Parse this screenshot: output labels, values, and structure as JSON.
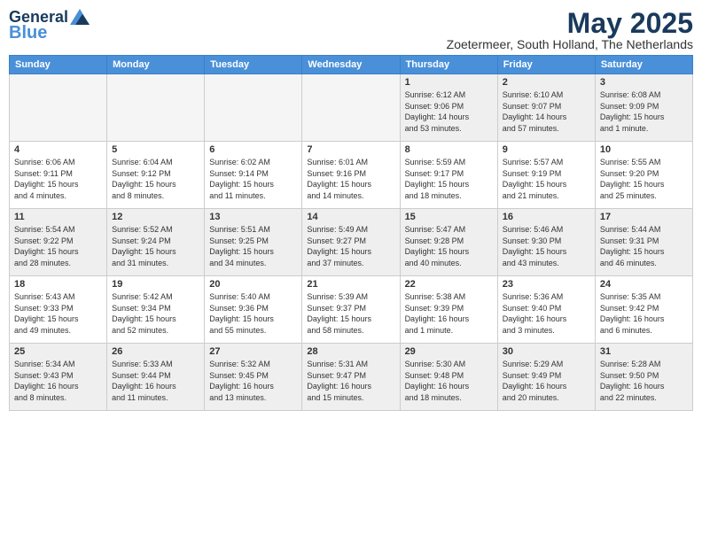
{
  "header": {
    "logo_line1": "General",
    "logo_line2": "Blue",
    "month": "May 2025",
    "location": "Zoetermeer, South Holland, The Netherlands"
  },
  "days_of_week": [
    "Sunday",
    "Monday",
    "Tuesday",
    "Wednesday",
    "Thursday",
    "Friday",
    "Saturday"
  ],
  "weeks": [
    [
      {
        "day": "",
        "info": "",
        "empty": true
      },
      {
        "day": "",
        "info": "",
        "empty": true
      },
      {
        "day": "",
        "info": "",
        "empty": true
      },
      {
        "day": "",
        "info": "",
        "empty": true
      },
      {
        "day": "1",
        "info": "Sunrise: 6:12 AM\nSunset: 9:06 PM\nDaylight: 14 hours\nand 53 minutes."
      },
      {
        "day": "2",
        "info": "Sunrise: 6:10 AM\nSunset: 9:07 PM\nDaylight: 14 hours\nand 57 minutes."
      },
      {
        "day": "3",
        "info": "Sunrise: 6:08 AM\nSunset: 9:09 PM\nDaylight: 15 hours\nand 1 minute."
      }
    ],
    [
      {
        "day": "4",
        "info": "Sunrise: 6:06 AM\nSunset: 9:11 PM\nDaylight: 15 hours\nand 4 minutes."
      },
      {
        "day": "5",
        "info": "Sunrise: 6:04 AM\nSunset: 9:12 PM\nDaylight: 15 hours\nand 8 minutes."
      },
      {
        "day": "6",
        "info": "Sunrise: 6:02 AM\nSunset: 9:14 PM\nDaylight: 15 hours\nand 11 minutes."
      },
      {
        "day": "7",
        "info": "Sunrise: 6:01 AM\nSunset: 9:16 PM\nDaylight: 15 hours\nand 14 minutes."
      },
      {
        "day": "8",
        "info": "Sunrise: 5:59 AM\nSunset: 9:17 PM\nDaylight: 15 hours\nand 18 minutes."
      },
      {
        "day": "9",
        "info": "Sunrise: 5:57 AM\nSunset: 9:19 PM\nDaylight: 15 hours\nand 21 minutes."
      },
      {
        "day": "10",
        "info": "Sunrise: 5:55 AM\nSunset: 9:20 PM\nDaylight: 15 hours\nand 25 minutes."
      }
    ],
    [
      {
        "day": "11",
        "info": "Sunrise: 5:54 AM\nSunset: 9:22 PM\nDaylight: 15 hours\nand 28 minutes."
      },
      {
        "day": "12",
        "info": "Sunrise: 5:52 AM\nSunset: 9:24 PM\nDaylight: 15 hours\nand 31 minutes."
      },
      {
        "day": "13",
        "info": "Sunrise: 5:51 AM\nSunset: 9:25 PM\nDaylight: 15 hours\nand 34 minutes."
      },
      {
        "day": "14",
        "info": "Sunrise: 5:49 AM\nSunset: 9:27 PM\nDaylight: 15 hours\nand 37 minutes."
      },
      {
        "day": "15",
        "info": "Sunrise: 5:47 AM\nSunset: 9:28 PM\nDaylight: 15 hours\nand 40 minutes."
      },
      {
        "day": "16",
        "info": "Sunrise: 5:46 AM\nSunset: 9:30 PM\nDaylight: 15 hours\nand 43 minutes."
      },
      {
        "day": "17",
        "info": "Sunrise: 5:44 AM\nSunset: 9:31 PM\nDaylight: 15 hours\nand 46 minutes."
      }
    ],
    [
      {
        "day": "18",
        "info": "Sunrise: 5:43 AM\nSunset: 9:33 PM\nDaylight: 15 hours\nand 49 minutes."
      },
      {
        "day": "19",
        "info": "Sunrise: 5:42 AM\nSunset: 9:34 PM\nDaylight: 15 hours\nand 52 minutes."
      },
      {
        "day": "20",
        "info": "Sunrise: 5:40 AM\nSunset: 9:36 PM\nDaylight: 15 hours\nand 55 minutes."
      },
      {
        "day": "21",
        "info": "Sunrise: 5:39 AM\nSunset: 9:37 PM\nDaylight: 15 hours\nand 58 minutes."
      },
      {
        "day": "22",
        "info": "Sunrise: 5:38 AM\nSunset: 9:39 PM\nDaylight: 16 hours\nand 1 minute."
      },
      {
        "day": "23",
        "info": "Sunrise: 5:36 AM\nSunset: 9:40 PM\nDaylight: 16 hours\nand 3 minutes."
      },
      {
        "day": "24",
        "info": "Sunrise: 5:35 AM\nSunset: 9:42 PM\nDaylight: 16 hours\nand 6 minutes."
      }
    ],
    [
      {
        "day": "25",
        "info": "Sunrise: 5:34 AM\nSunset: 9:43 PM\nDaylight: 16 hours\nand 8 minutes."
      },
      {
        "day": "26",
        "info": "Sunrise: 5:33 AM\nSunset: 9:44 PM\nDaylight: 16 hours\nand 11 minutes."
      },
      {
        "day": "27",
        "info": "Sunrise: 5:32 AM\nSunset: 9:45 PM\nDaylight: 16 hours\nand 13 minutes."
      },
      {
        "day": "28",
        "info": "Sunrise: 5:31 AM\nSunset: 9:47 PM\nDaylight: 16 hours\nand 15 minutes."
      },
      {
        "day": "29",
        "info": "Sunrise: 5:30 AM\nSunset: 9:48 PM\nDaylight: 16 hours\nand 18 minutes."
      },
      {
        "day": "30",
        "info": "Sunrise: 5:29 AM\nSunset: 9:49 PM\nDaylight: 16 hours\nand 20 minutes."
      },
      {
        "day": "31",
        "info": "Sunrise: 5:28 AM\nSunset: 9:50 PM\nDaylight: 16 hours\nand 22 minutes."
      }
    ]
  ],
  "gray_rows": [
    0,
    2,
    4
  ],
  "accent_color": "#4a90d9",
  "header_bg": "#3a78c9"
}
